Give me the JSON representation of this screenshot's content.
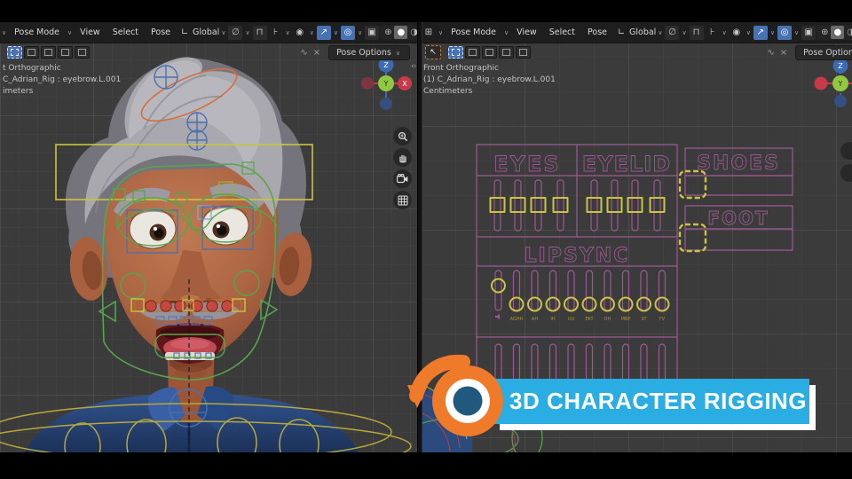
{
  "icons": {
    "caret": "∨",
    "axis": "∟",
    "link": "∅",
    "magnet": "⊓",
    "snap_target": "⊦",
    "pivot": "◉",
    "gizmo": "↗",
    "overlays": "◎",
    "xray": "▣",
    "wireframe": "⊕",
    "solid": "●",
    "material": "◑",
    "rendered": "○",
    "tool_a": "∿",
    "tool_x": "×",
    "cursor": "↖",
    "handle": "‹›",
    "editor": "⊞"
  },
  "left_viewport": {
    "header": {
      "mode": "Pose Mode",
      "menus": [
        "View",
        "Select",
        "Pose"
      ],
      "orientation": "Global"
    },
    "tool_row": {
      "pose_options": "Pose Options"
    },
    "info": [
      "t Orthographic",
      "C_Adrian_Rig : eyebrow.L.001",
      "imeters"
    ],
    "gizmo": {
      "x": "X",
      "y": "Y",
      "z": "Z"
    },
    "nav_icons": [
      "zoom-icon",
      "hand-icon",
      "camera-icon",
      "grid-icon"
    ]
  },
  "right_viewport": {
    "header": {
      "mode": "Pose Mode",
      "menus": [
        "View",
        "Select",
        "Pose"
      ],
      "orientation": "Global"
    },
    "tool_row": {
      "pose_options": "Pose Options"
    },
    "info": [
      "Front Orthographic",
      "(1) C_Adrian_Rig : eyebrow.L.001",
      "Centimeters"
    ],
    "gizmo": {
      "y": "Y",
      "z": "Z"
    },
    "rig_panel": {
      "eyes_title": "EYES",
      "eyelid_title": "EYELID",
      "lipsync_title": "LIPSYNC",
      "shoes_title": "SHOES",
      "foot_title": "FOOT",
      "lipsync_labels": [
        "AGHH",
        "AH",
        "IH",
        "UU",
        "EKT",
        "OH",
        "MBP",
        "ST",
        "FV"
      ],
      "outline_color": "#9c5993",
      "handle_color": "#cbc344"
    }
  },
  "banner": {
    "title": "3D CHARACTER RIGGING",
    "bg_color": "#29ADE3",
    "shadow_color": "#FFFFFF",
    "logo": "blender-logo",
    "logo_orange": "#EE7A2A",
    "logo_center_blue": "#21587E"
  }
}
